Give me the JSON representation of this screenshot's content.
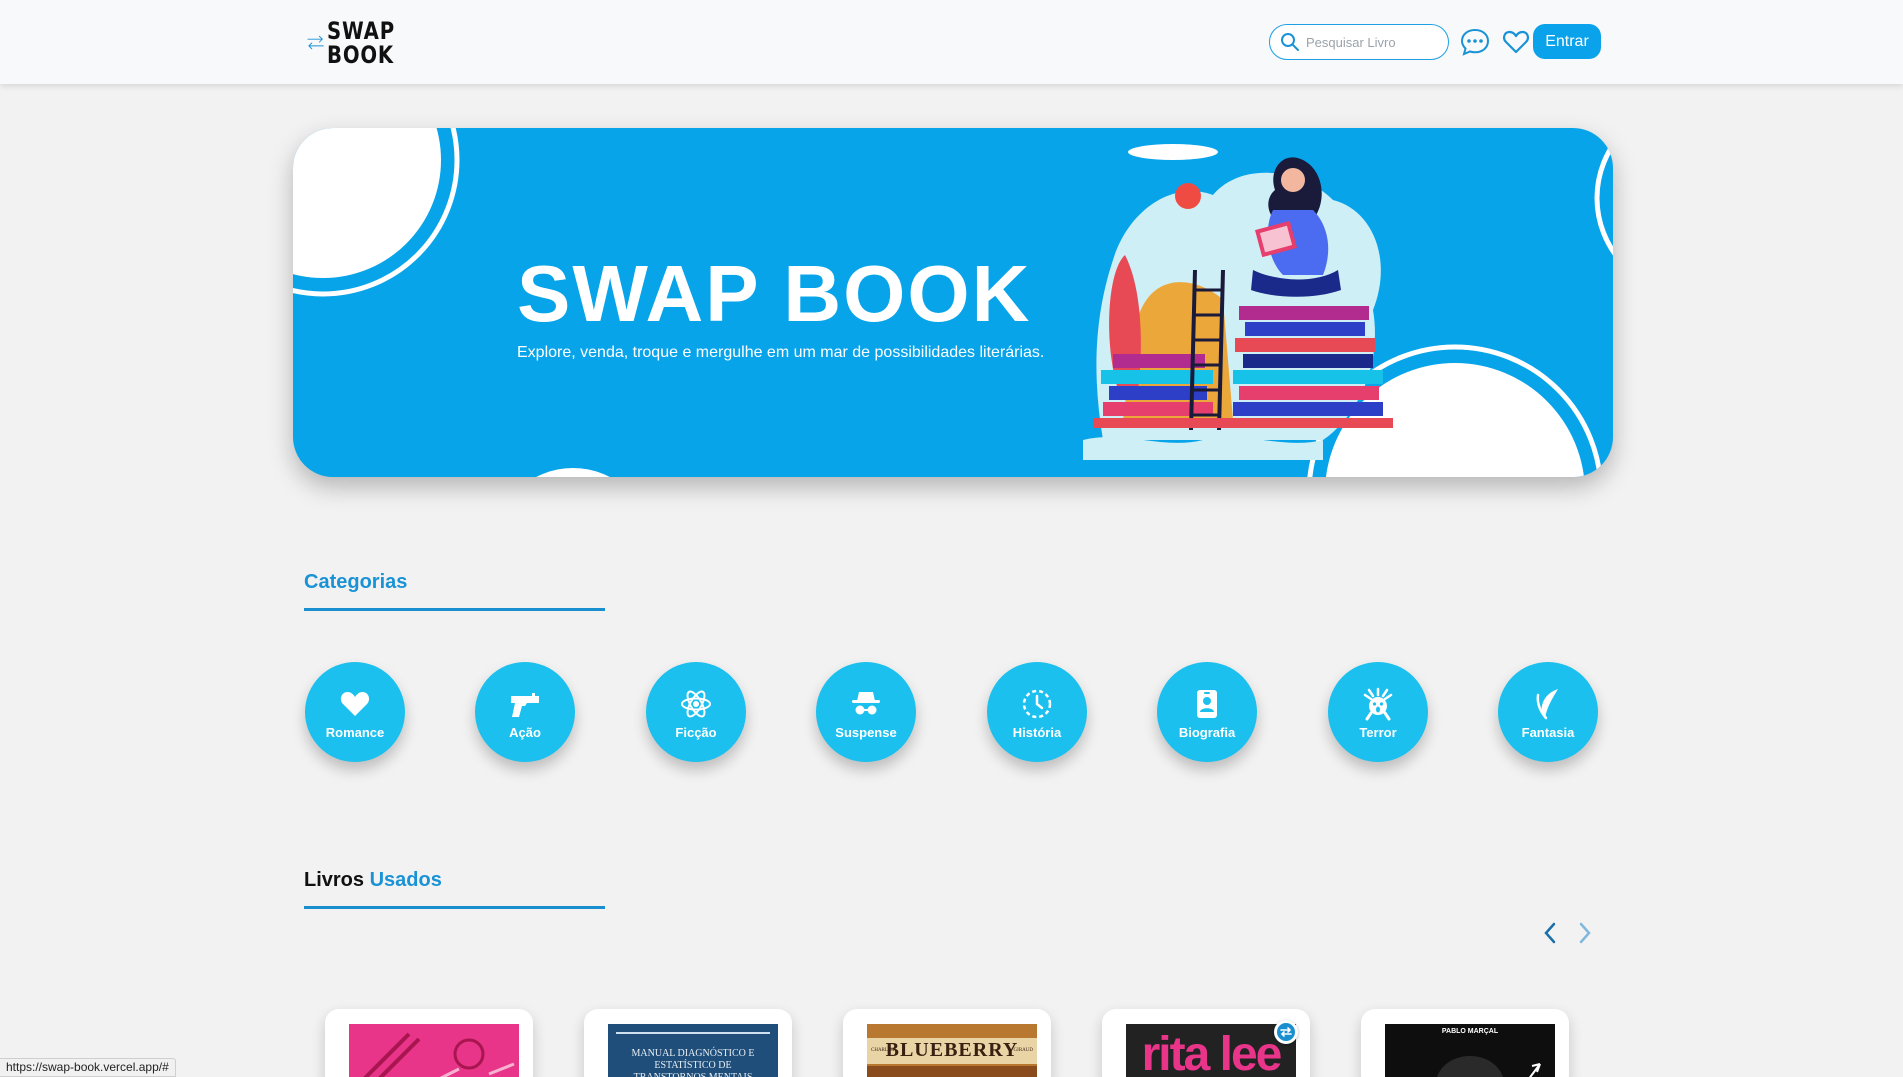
{
  "header": {
    "logo_line1": "SWAP",
    "logo_line2": "BOOK",
    "search_placeholder": "Pesquisar Livro",
    "login_label": "Entrar",
    "icons": [
      "search-icon",
      "chat-icon",
      "heart-icon"
    ]
  },
  "banner": {
    "title": "SWAP BOOK",
    "subtitle": "Explore, venda, troque e mergulhe em um mar de possibilidades literárias."
  },
  "categories": {
    "title": "Categorias",
    "items": [
      {
        "label": "Romance",
        "icon": "heart-icon"
      },
      {
        "label": "Ação",
        "icon": "gun-icon"
      },
      {
        "label": "Ficção",
        "icon": "atom-icon"
      },
      {
        "label": "Suspense",
        "icon": "spy-icon"
      },
      {
        "label": "História",
        "icon": "history-clock-icon"
      },
      {
        "label": "Biografia",
        "icon": "id-badge-icon"
      },
      {
        "label": "Terror",
        "icon": "scream-icon"
      },
      {
        "label": "Fantasia",
        "icon": "feather-icon"
      }
    ]
  },
  "used_books": {
    "title_part1": "Livros",
    "title_part2": "Usados",
    "books": [
      {
        "cover_text": ""
      },
      {
        "cover_text": "MANUAL DIAGNÓSTICO E ESTATÍSTICO DE TRANSTORNOS MENTAIS"
      },
      {
        "cover_text": "BLUEBERRY",
        "cover_small_left": "CHARLIER",
        "cover_small_right": "GIRAUD"
      },
      {
        "cover_text": "rita lee"
      },
      {
        "cover_text": "PABLO MARÇAL"
      }
    ]
  },
  "status_url": "https://swap-book.vercel.app/#",
  "colors": {
    "accent": "#0aa2ea",
    "category": "#1bc0ee",
    "heading_blue": "#1a93d6",
    "banner": "#08a4ea"
  }
}
